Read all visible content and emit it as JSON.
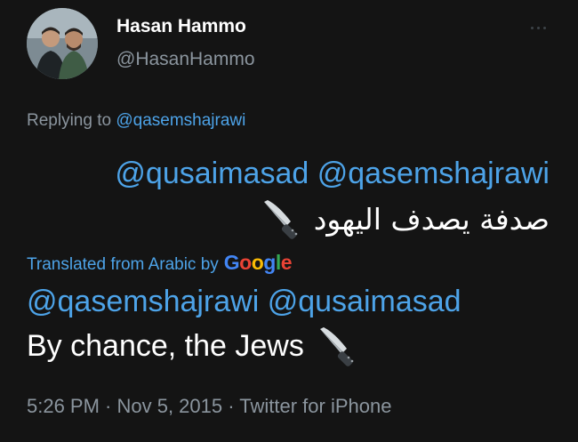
{
  "tweet": {
    "author": {
      "name": "Hasan Hammo",
      "handle": "@HasanHammo"
    },
    "replying_prefix": "Replying to ",
    "replying_to": "@qasemshajrawi",
    "original": {
      "mentions": "@qusaimasad @qasemshajrawi",
      "text": "صدفة يصدف اليهود",
      "emoji": "kitchen-knife-icon"
    },
    "translation_label": "Translated from Arabic by",
    "translation_provider": [
      "G",
      "o",
      "o",
      "g",
      "l",
      "e"
    ],
    "translated": {
      "mentions": "@qasemshajrawi @qusaimasad",
      "text": "By chance, the Jews",
      "emoji": "kitchen-knife-icon"
    },
    "meta": "5:26 PM · Nov 5, 2015 · Twitter for iPhone"
  },
  "colors": {
    "background": "#141414",
    "link": "#4da3e8",
    "secondary_text": "#8b959e",
    "primary_text": "#ffffff"
  }
}
